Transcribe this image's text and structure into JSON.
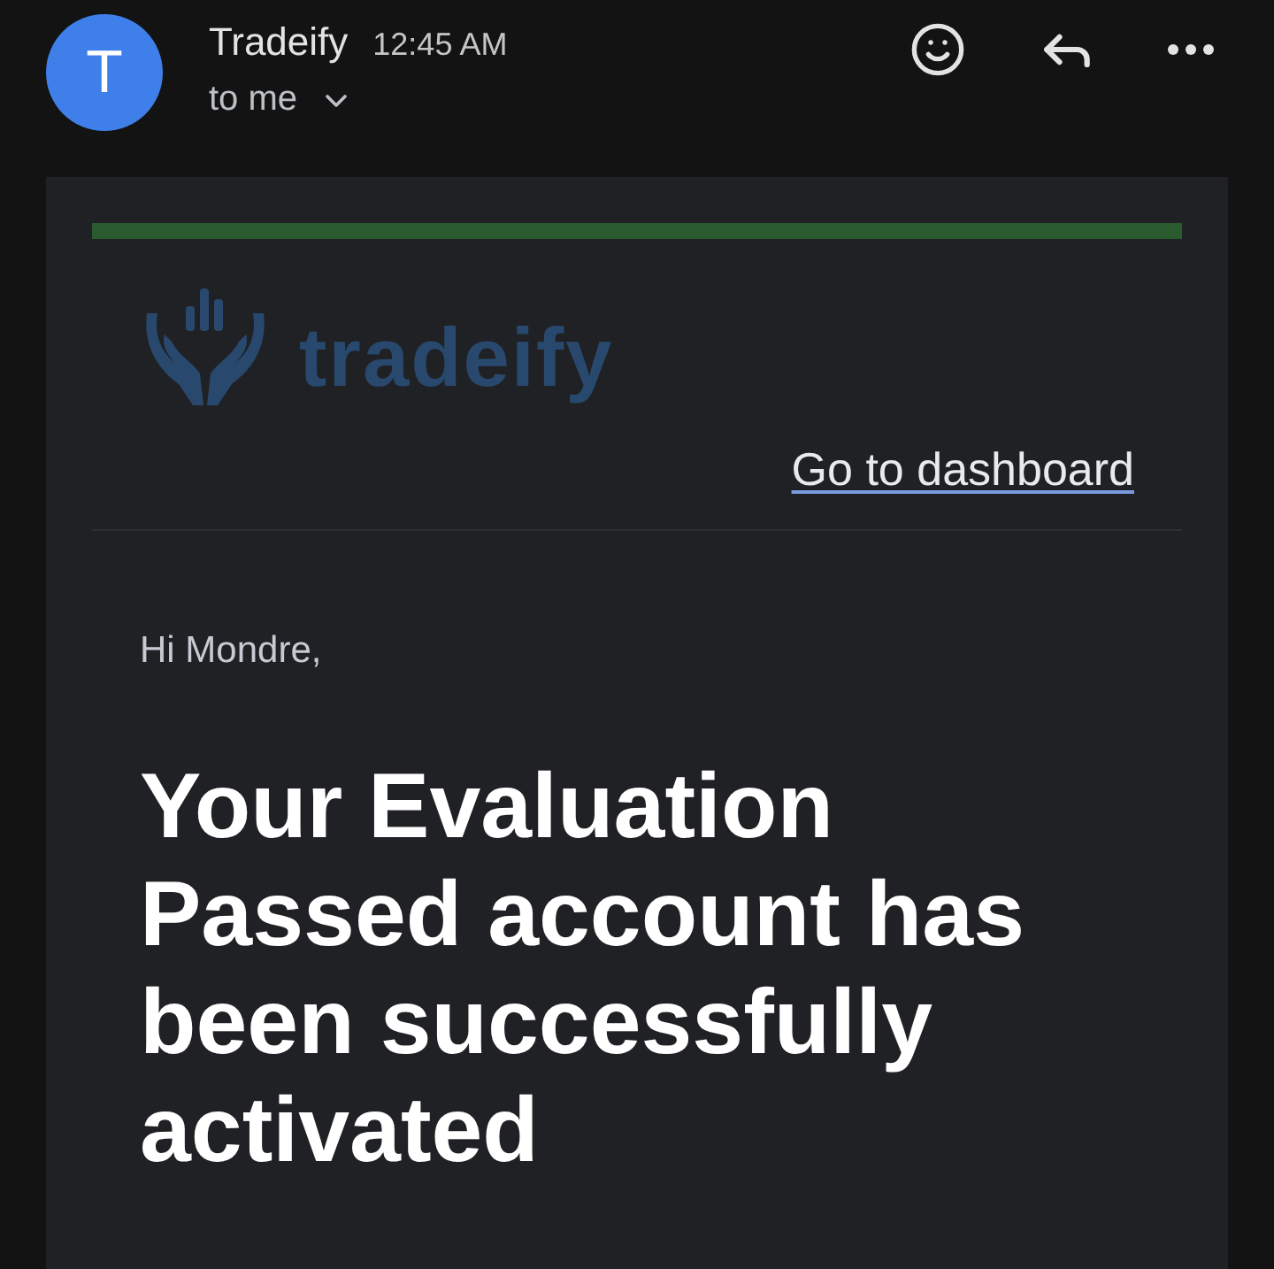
{
  "header": {
    "avatar_letter": "T",
    "sender": "Tradeify",
    "time": "12:45 AM",
    "recipient": "to me"
  },
  "email": {
    "logo_wordmark": "tradeify",
    "dashboard_link": "Go to dashboard",
    "greeting": "Hi Mondre,",
    "headline": "Your Evaluation Passed account has been successfully activated"
  }
}
